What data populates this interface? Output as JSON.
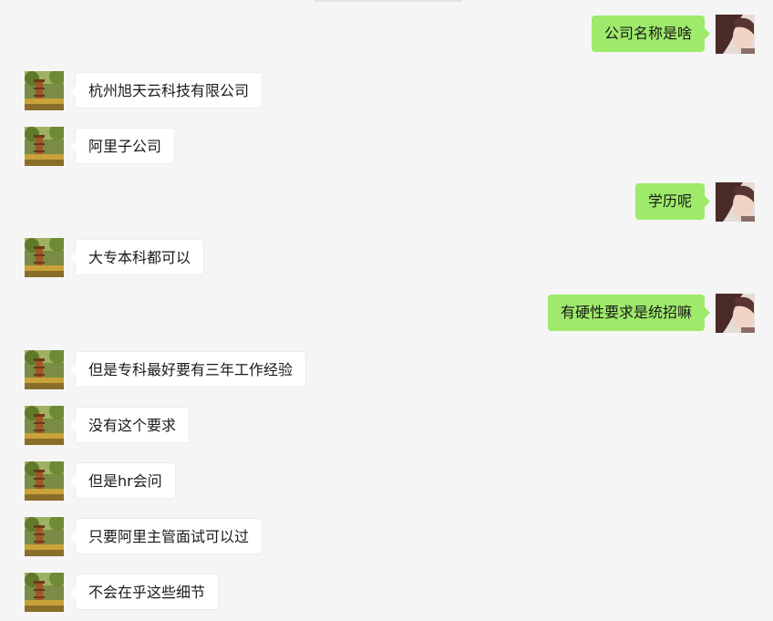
{
  "messages": [
    {
      "side": "right",
      "text": "公司名称是啥"
    },
    {
      "side": "left",
      "text": "杭州旭天云科技有限公司"
    },
    {
      "side": "left",
      "text": "阿里子公司"
    },
    {
      "side": "right",
      "text": "学历呢"
    },
    {
      "side": "left",
      "text": "大专本科都可以"
    },
    {
      "side": "right",
      "text": "有硬性要求是统招嘛"
    },
    {
      "side": "left",
      "text": "但是专科最好要有三年工作经验"
    },
    {
      "side": "left",
      "text": "没有这个要求"
    },
    {
      "side": "left",
      "text": "但是hr会问"
    },
    {
      "side": "left",
      "text": "只要阿里主管面试可以过"
    },
    {
      "side": "left",
      "text": "不会在乎这些细节"
    }
  ],
  "colors": {
    "background": "#f5f5f5",
    "incoming_bubble": "#ffffff",
    "outgoing_bubble": "#9eea6a"
  },
  "icons": {
    "incoming_avatar": "pagoda-landscape-avatar-icon",
    "outgoing_avatar": "person-photo-avatar-icon"
  }
}
